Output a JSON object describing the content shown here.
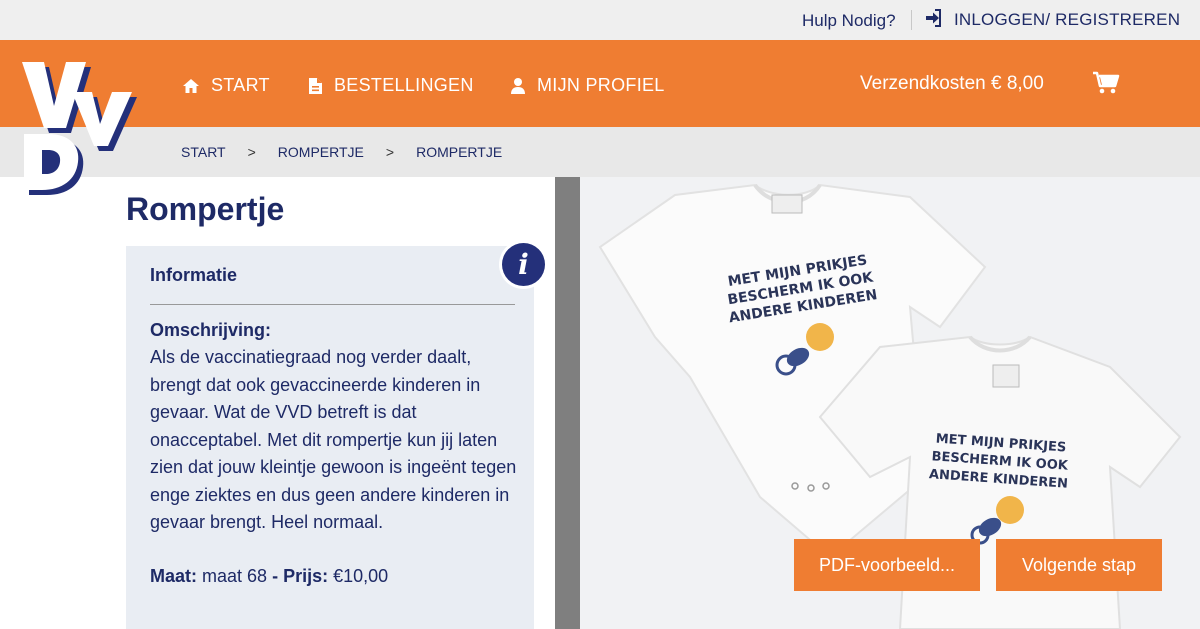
{
  "topbar": {
    "help": "Hulp Nodig?",
    "login": "INLOGGEN/ REGISTREREN"
  },
  "nav": {
    "items": [
      {
        "label": "START",
        "icon": "home-icon"
      },
      {
        "label": "BESTELLINGEN",
        "icon": "document-icon"
      },
      {
        "label": "MIJN PROFIEL",
        "icon": "user-icon"
      }
    ],
    "shipping": "Verzendkosten € 8,00",
    "cart_icon": "cart-icon"
  },
  "logo": {
    "text": "VVD"
  },
  "breadcrumb": [
    "START",
    "ROMPERTJE",
    "ROMPERTJE"
  ],
  "breadcrumb_separator": ">",
  "product": {
    "title": "Rompertje",
    "info_heading": "Informatie",
    "description_label": "Omschrijving:",
    "description": "Als de vaccinatiegraad nog verder daalt, brengt dat ook gevaccineerde kinderen in gevaar. Wat de VVD betreft is dat onacceptabel. Met dit rompertje kun jij laten zien dat jouw kleintje gewoon is ingeënt tegen enge ziektes en dus geen andere kinderen in gevaar brengt. Heel normaal.",
    "size_label": "Maat:",
    "size_value": "maat 68",
    "price_label": "- Prijs:",
    "price_value": "€10,00",
    "info_icon_glyph": "i"
  },
  "image_print": {
    "line1": "MET MIJN PRIKJES",
    "line2": "BESCHERM IK OOK",
    "line3": "ANDERE KINDEREN"
  },
  "buttons": {
    "pdf": "PDF-voorbeeld...",
    "next": "Volgende stap"
  },
  "colors": {
    "accent": "#ef7d32",
    "navy": "#1e2a66",
    "panel": "#e9edf3"
  }
}
